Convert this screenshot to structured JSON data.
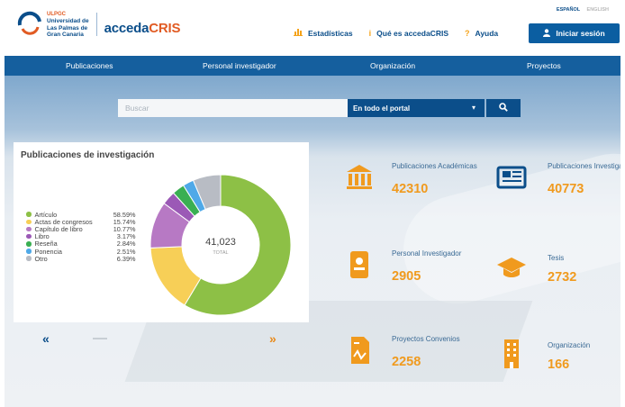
{
  "header": {
    "logo_acronym": "ULPGC",
    "logo_university": [
      "Universidad de",
      "Las Palmas de",
      "Gran Canaria"
    ],
    "brand_prefix": "acceda",
    "brand_suffix": "CRIS",
    "languages": {
      "active": "ESPAÑOL",
      "inactive": "ENGLISH"
    },
    "links": [
      {
        "icon": "bar-chart-icon",
        "label": "Estadísticas"
      },
      {
        "icon": "info-icon",
        "label": "Qué es accedaCRIS"
      },
      {
        "icon": "question-icon",
        "label": "Ayuda"
      }
    ],
    "login_label": "Iniciar sesión"
  },
  "nav": {
    "items": [
      "Publicaciones",
      "Personal investigador",
      "Organización",
      "Proyectos"
    ]
  },
  "search": {
    "placeholder": "Buscar",
    "scope_selected": "En todo el portal"
  },
  "colors": {
    "primary": "#0b4e8a",
    "nav": "#155f9e",
    "accent": "#f09a1e"
  },
  "chart_card": {
    "title": "Publicaciones de investigación",
    "total_value": "41,023",
    "total_label": "TOTAL"
  },
  "chart_data": {
    "type": "pie",
    "title": "Publicaciones de investigación",
    "donut": true,
    "categories": [
      "Artículo",
      "Actas de congresos",
      "Capítulo de libro",
      "Libro",
      "Reseña",
      "Ponencia",
      "Otro"
    ],
    "values": [
      58.59,
      15.74,
      10.77,
      3.17,
      2.84,
      2.51,
      6.39
    ],
    "labels": [
      "58.59%",
      "15.74%",
      "10.77%",
      "3.17%",
      "2.84%",
      "2.51%",
      "6.39%"
    ],
    "colors": [
      "#8dc046",
      "#f7cf57",
      "#b779c4",
      "#9b59b6",
      "#3aaf52",
      "#4fa9e8",
      "#b8bcc4"
    ],
    "center_total": "41,023",
    "legend_position": "left"
  },
  "stats": [
    {
      "icon": "institution-icon",
      "label": "Publicaciones Académicas",
      "value": "42310"
    },
    {
      "icon": "newspaper-icon",
      "label": "Publicaciones Investigación",
      "value": "40773"
    },
    {
      "icon": "id-badge-icon",
      "label": "Personal Investigador",
      "value": "2905"
    },
    {
      "icon": "graduation-cap-icon",
      "label": "Tesis",
      "value": "2732"
    },
    {
      "icon": "project-document-icon",
      "label": "Proyectos Convenios",
      "value": "2258"
    },
    {
      "icon": "building-icon",
      "label": "Organización",
      "value": "166"
    }
  ]
}
